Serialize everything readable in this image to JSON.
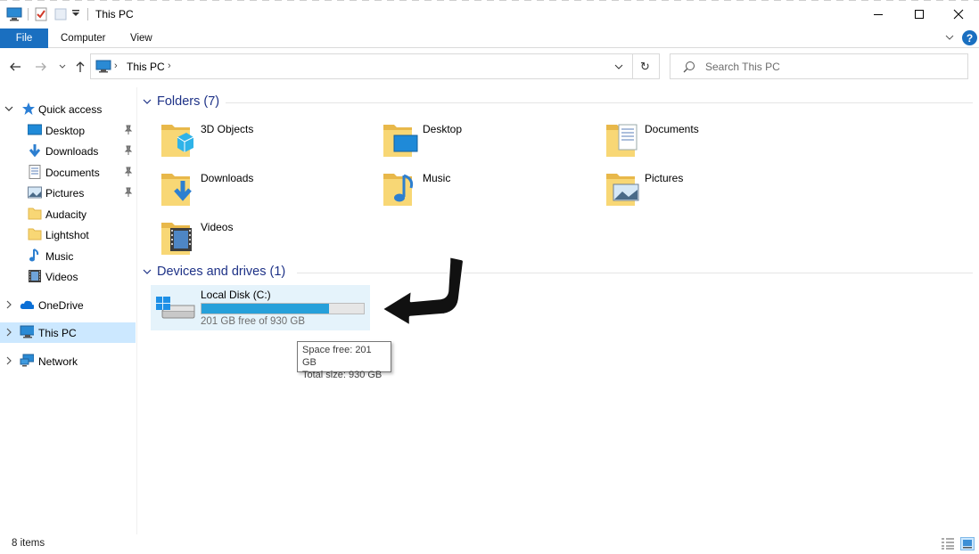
{
  "window": {
    "title": "This PC",
    "minimize": "—",
    "maximize": "☐",
    "close": "✕"
  },
  "ribbon": {
    "file": "File",
    "tabs": [
      "Computer",
      "View"
    ],
    "help": "?"
  },
  "address": {
    "path": "This PC",
    "search_placeholder": "Search This PC"
  },
  "sidebar": {
    "quick_access": "Quick access",
    "quick_items": [
      {
        "label": "Desktop",
        "pinned": true
      },
      {
        "label": "Downloads",
        "pinned": true
      },
      {
        "label": "Documents",
        "pinned": true
      },
      {
        "label": "Pictures",
        "pinned": true
      },
      {
        "label": "Audacity",
        "pinned": false
      },
      {
        "label": "Lightshot",
        "pinned": false
      },
      {
        "label": "Music",
        "pinned": false
      },
      {
        "label": "Videos",
        "pinned": false
      }
    ],
    "onedrive": "OneDrive",
    "this_pc": "This PC",
    "network": "Network"
  },
  "folders": {
    "header": "Folders (7)",
    "items": [
      "3D Objects",
      "Desktop",
      "Documents",
      "Downloads",
      "Music",
      "Pictures",
      "Videos"
    ]
  },
  "devices": {
    "header": "Devices and drives (1)",
    "drive": {
      "name": "Local Disk (C:)",
      "free_text": "201 GB free of 930 GB",
      "used_fraction": 0.784
    }
  },
  "tooltip": {
    "line1": "Space free: 201 GB",
    "line2": "Total size: 930 GB"
  },
  "status": {
    "count": "8 items"
  },
  "colors": {
    "accent": "#1a6fc0",
    "selection": "#cce8ff",
    "drive_hover": "#e5f3fb",
    "drive_fill": "#26a0da",
    "group_header": "#1e3287"
  }
}
